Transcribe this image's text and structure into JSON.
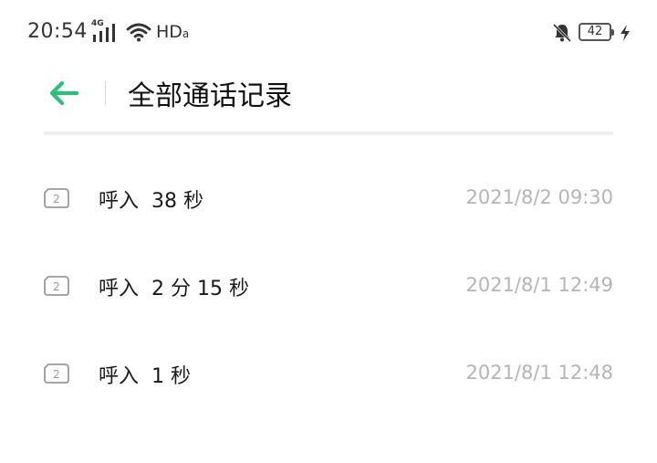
{
  "status_bar": {
    "time": "20:54",
    "network": "4G",
    "hd": "HD",
    "hd_sub": "a",
    "battery": "42",
    "icons": [
      "signal-icon",
      "wifi-icon",
      "bell-off-icon",
      "battery-icon",
      "charging-bolt-icon"
    ]
  },
  "header": {
    "back_icon": "back-arrow-icon",
    "title": "全部通话记录"
  },
  "calls": [
    {
      "description": "呼入  38 秒",
      "datetime": "2021/8/2 09:30",
      "sim": "2"
    },
    {
      "description": "呼入  2 分 15 秒",
      "datetime": "2021/8/1 12:49",
      "sim": "2"
    },
    {
      "description": "呼入  1 秒",
      "datetime": "2021/8/1 12:48",
      "sim": "2"
    }
  ],
  "colors": {
    "accent": "#2ebf7a",
    "secondary_text": "#b5b5b5",
    "divider": "#eeeeee"
  }
}
